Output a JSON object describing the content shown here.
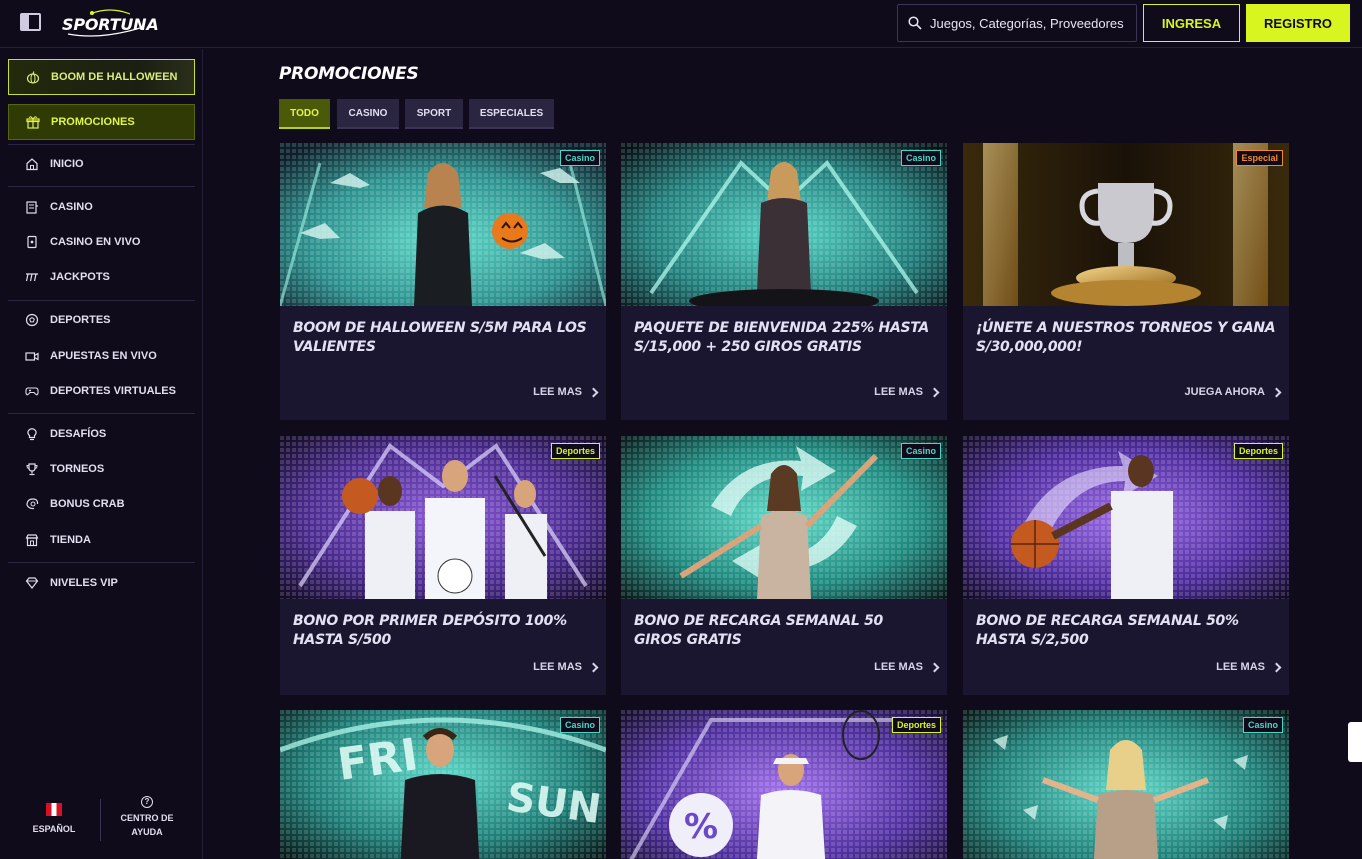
{
  "header": {
    "logo_text": "SPORTUNA",
    "search_placeholder": "Juegos, Categorías, Proveedores",
    "login_label": "INGRESA",
    "register_label": "REGISTRO"
  },
  "sidebar": {
    "highlights": [
      {
        "label": "BOOM DE HALLOWEEN",
        "icon": "pumpkin-icon"
      },
      {
        "label": "PROMOCIONES",
        "icon": "gift-icon"
      }
    ],
    "items": [
      {
        "label": "INICIO",
        "icon": "home-icon"
      },
      {
        "label": "CASINO",
        "icon": "casino-icon"
      },
      {
        "label": "CASINO EN VIVO",
        "icon": "live-casino-icon"
      },
      {
        "label": "JACKPOTS",
        "icon": "jackpot-icon"
      },
      {
        "label": "DEPORTES",
        "icon": "soccer-ball-icon"
      },
      {
        "label": "APUESTAS EN VIVO",
        "icon": "video-icon"
      },
      {
        "label": "DEPORTES VIRTUALES",
        "icon": "gamepad-icon"
      },
      {
        "label": "DESAFÍOS",
        "icon": "lightbulb-icon"
      },
      {
        "label": "TORNEOS",
        "icon": "trophy-icon"
      },
      {
        "label": "BONUS CRAB",
        "icon": "crab-icon"
      },
      {
        "label": "TIENDA",
        "icon": "store-icon"
      },
      {
        "label": "NIVELES VIP",
        "icon": "diamond-icon"
      }
    ],
    "footer": {
      "language": "ESPAÑOL",
      "help_line1": "CENTRO DE",
      "help_line2": "AYUDA"
    }
  },
  "main": {
    "title": "PROMOCIONES",
    "tabs": [
      "TODO",
      "CASINO",
      "SPORT",
      "ESPECIALES"
    ],
    "active_tab": "TODO",
    "cards": [
      {
        "badge": "Casino",
        "title": "BOOM DE HALLOWEEN S/5M PARA LOS VALIENTES",
        "cta": "LEE MAS"
      },
      {
        "badge": "Casino",
        "title": "PAQUETE DE BIENVENIDA 225% HASTA S/15,000 + 250 GIROS GRATIS",
        "cta": "LEE MAS"
      },
      {
        "badge": "Especial",
        "title": "¡ÚNETE A NUESTROS TORNEOS Y GANA S/30,000,000!",
        "cta": "JUEGA AHORA"
      },
      {
        "badge": "Deportes",
        "title": "BONO POR PRIMER DEPÓSITO 100% HASTA S/500",
        "cta": "LEE MAS"
      },
      {
        "badge": "Casino",
        "title": "BONO DE RECARGA SEMANAL 50 GIROS GRATIS",
        "cta": "LEE MAS"
      },
      {
        "badge": "Deportes",
        "title": "BONO DE RECARGA SEMANAL 50% HASTA S/2,500",
        "cta": "LEE MAS"
      },
      {
        "badge": "Casino",
        "title": "",
        "cta": "",
        "image_text_left": "FRI",
        "image_text_right": "SUN"
      },
      {
        "badge": "Deportes",
        "title": "",
        "cta": "",
        "image_text": "%"
      },
      {
        "badge": "Casino",
        "title": "",
        "cta": ""
      }
    ]
  },
  "colors": {
    "accent": "#d9f51f",
    "background": "#0f0b1a",
    "card_bg": "#1b1630",
    "badge_casino": "#48d6c8",
    "badge_especial": "#f08a2a",
    "badge_deportes": "#d9f51f"
  }
}
